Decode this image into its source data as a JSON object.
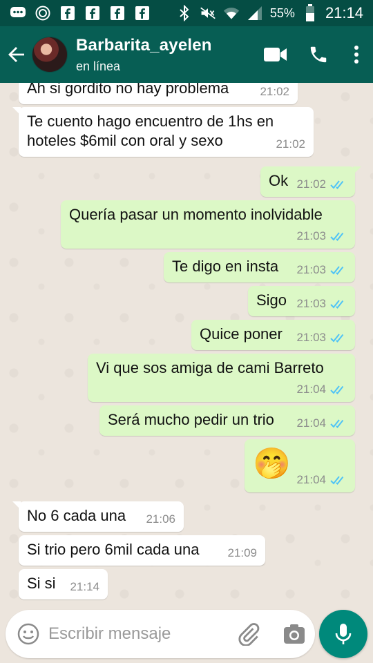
{
  "status_bar": {
    "battery": "55%",
    "time": "21:14",
    "icons": [
      "messages-icon",
      "sync-icon",
      "facebook-icon",
      "facebook-icon",
      "facebook-icon",
      "facebook-icon",
      "bluetooth-icon",
      "mute-icon",
      "wifi-icon",
      "signal-icon",
      "battery-icon"
    ]
  },
  "header": {
    "contact_name": "Barbarita_ayelen",
    "contact_status": "en línea",
    "icons": [
      "back-arrow-icon",
      "video-call-icon",
      "phone-call-icon",
      "more-options-icon"
    ]
  },
  "messages": [
    {
      "dir": "in",
      "text": "Ah si gordito no hay problema",
      "time": "21:02"
    },
    {
      "dir": "in",
      "text_lines": [
        "Te cuento hago encuentro de 1hs en",
        "hoteles $6mil con oral y sexo"
      ],
      "time": "21:02"
    },
    {
      "dir": "out",
      "text": "Ok",
      "time": "21:02",
      "status": "read"
    },
    {
      "dir": "out",
      "text": "Quería pasar un momento inolvidable",
      "time": "21:03",
      "status": "read"
    },
    {
      "dir": "out",
      "text": "Te digo en insta",
      "time": "21:03",
      "status": "read"
    },
    {
      "dir": "out",
      "text": "Sigo",
      "time": "21:03",
      "status": "read"
    },
    {
      "dir": "out",
      "text": "Quice poner",
      "time": "21:03",
      "status": "read"
    },
    {
      "dir": "out",
      "text": "Vi que sos amiga de cami Barreto",
      "time": "21:04",
      "status": "read"
    },
    {
      "dir": "out",
      "text": "Será mucho pedir un trio",
      "time": "21:04",
      "status": "read"
    },
    {
      "dir": "out",
      "emoji": "🤭",
      "time": "21:04",
      "status": "read"
    },
    {
      "dir": "in",
      "text": "No 6 cada una",
      "time": "21:06"
    },
    {
      "dir": "in",
      "text": "Si trio pero 6mil cada una",
      "time": "21:09"
    },
    {
      "dir": "in",
      "text": "Si si",
      "time": "21:14"
    }
  ],
  "input": {
    "placeholder": "Escribir mensaje",
    "value": ""
  },
  "colors": {
    "status_bar": "#054d44",
    "app_bar": "#075e54",
    "outgoing_bubble": "#dcf8c6",
    "incoming_bubble": "#ffffff",
    "chat_background": "#ece5dd",
    "read_tick": "#4fc3f7",
    "mic_button": "#00897b"
  }
}
